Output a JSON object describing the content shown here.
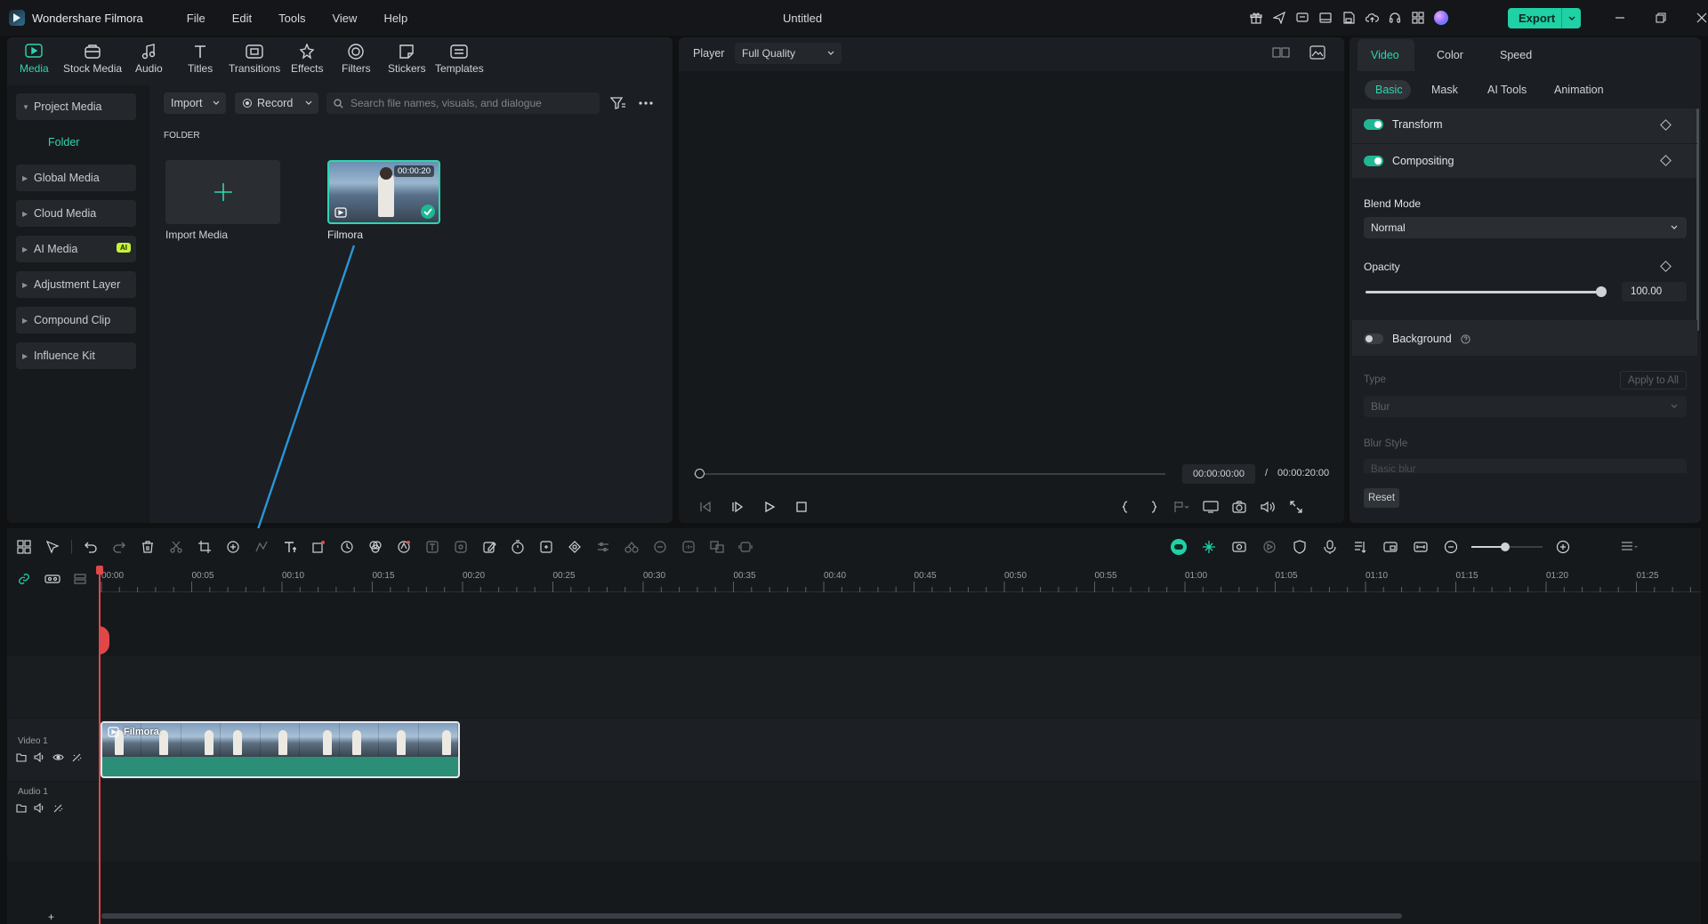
{
  "app": {
    "name": "Wondershare Filmora",
    "window_title": "Untitled"
  },
  "menu": [
    "File",
    "Edit",
    "Tools",
    "View",
    "Help"
  ],
  "export_label": "Export",
  "colors": {
    "accent": "#1fd1a5",
    "clip": "#2b8f78",
    "playhead": "#e04848"
  },
  "top_tabs": [
    "Media",
    "Stock Media",
    "Audio",
    "Titles",
    "Transitions",
    "Effects",
    "Filters",
    "Stickers",
    "Templates"
  ],
  "sidebar": {
    "project_media": "Project Media",
    "folder": "Folder",
    "items": [
      "Global Media",
      "Cloud Media",
      "AI Media",
      "Adjustment Layer",
      "Compound Clip",
      "Influence Kit"
    ],
    "ai_badge": "AI"
  },
  "media": {
    "import_label": "Import",
    "record_label": "Record",
    "search_placeholder": "Search file names, visuals, and dialogue",
    "folder_heading": "FOLDER",
    "import_media_label": "Import Media",
    "clip_name": "Filmora",
    "clip_duration": "00:00:20"
  },
  "player": {
    "label": "Player",
    "quality": "Full Quality",
    "current_time": "00:00:00:00",
    "separator": "/",
    "total_time": "00:00:20:00"
  },
  "inspector": {
    "tabs": [
      "Video",
      "Color",
      "Speed"
    ],
    "subtabs": [
      "Basic",
      "Mask",
      "AI Tools",
      "Animation"
    ],
    "transform": "Transform",
    "compositing": "Compositing",
    "blend_mode_label": "Blend Mode",
    "blend_mode_value": "Normal",
    "opacity_label": "Opacity",
    "opacity_value": "100.00",
    "background": "Background",
    "type_label": "Type",
    "apply_all": "Apply to All",
    "type_value": "Blur",
    "blur_style_label": "Blur Style",
    "blur_style_value": "Basic blur",
    "reset": "Reset"
  },
  "timeline": {
    "ruler": [
      "00:00",
      "00:05",
      "00:10",
      "00:15",
      "00:20",
      "00:25",
      "00:30",
      "00:35",
      "00:40",
      "00:45",
      "00:50",
      "00:55",
      "01:00",
      "01:05",
      "01:10",
      "01:15",
      "01:20",
      "01:25"
    ],
    "video_track": "Video 1",
    "audio_track": "Audio 1",
    "clip_label": "Filmora",
    "add_track": "+"
  }
}
